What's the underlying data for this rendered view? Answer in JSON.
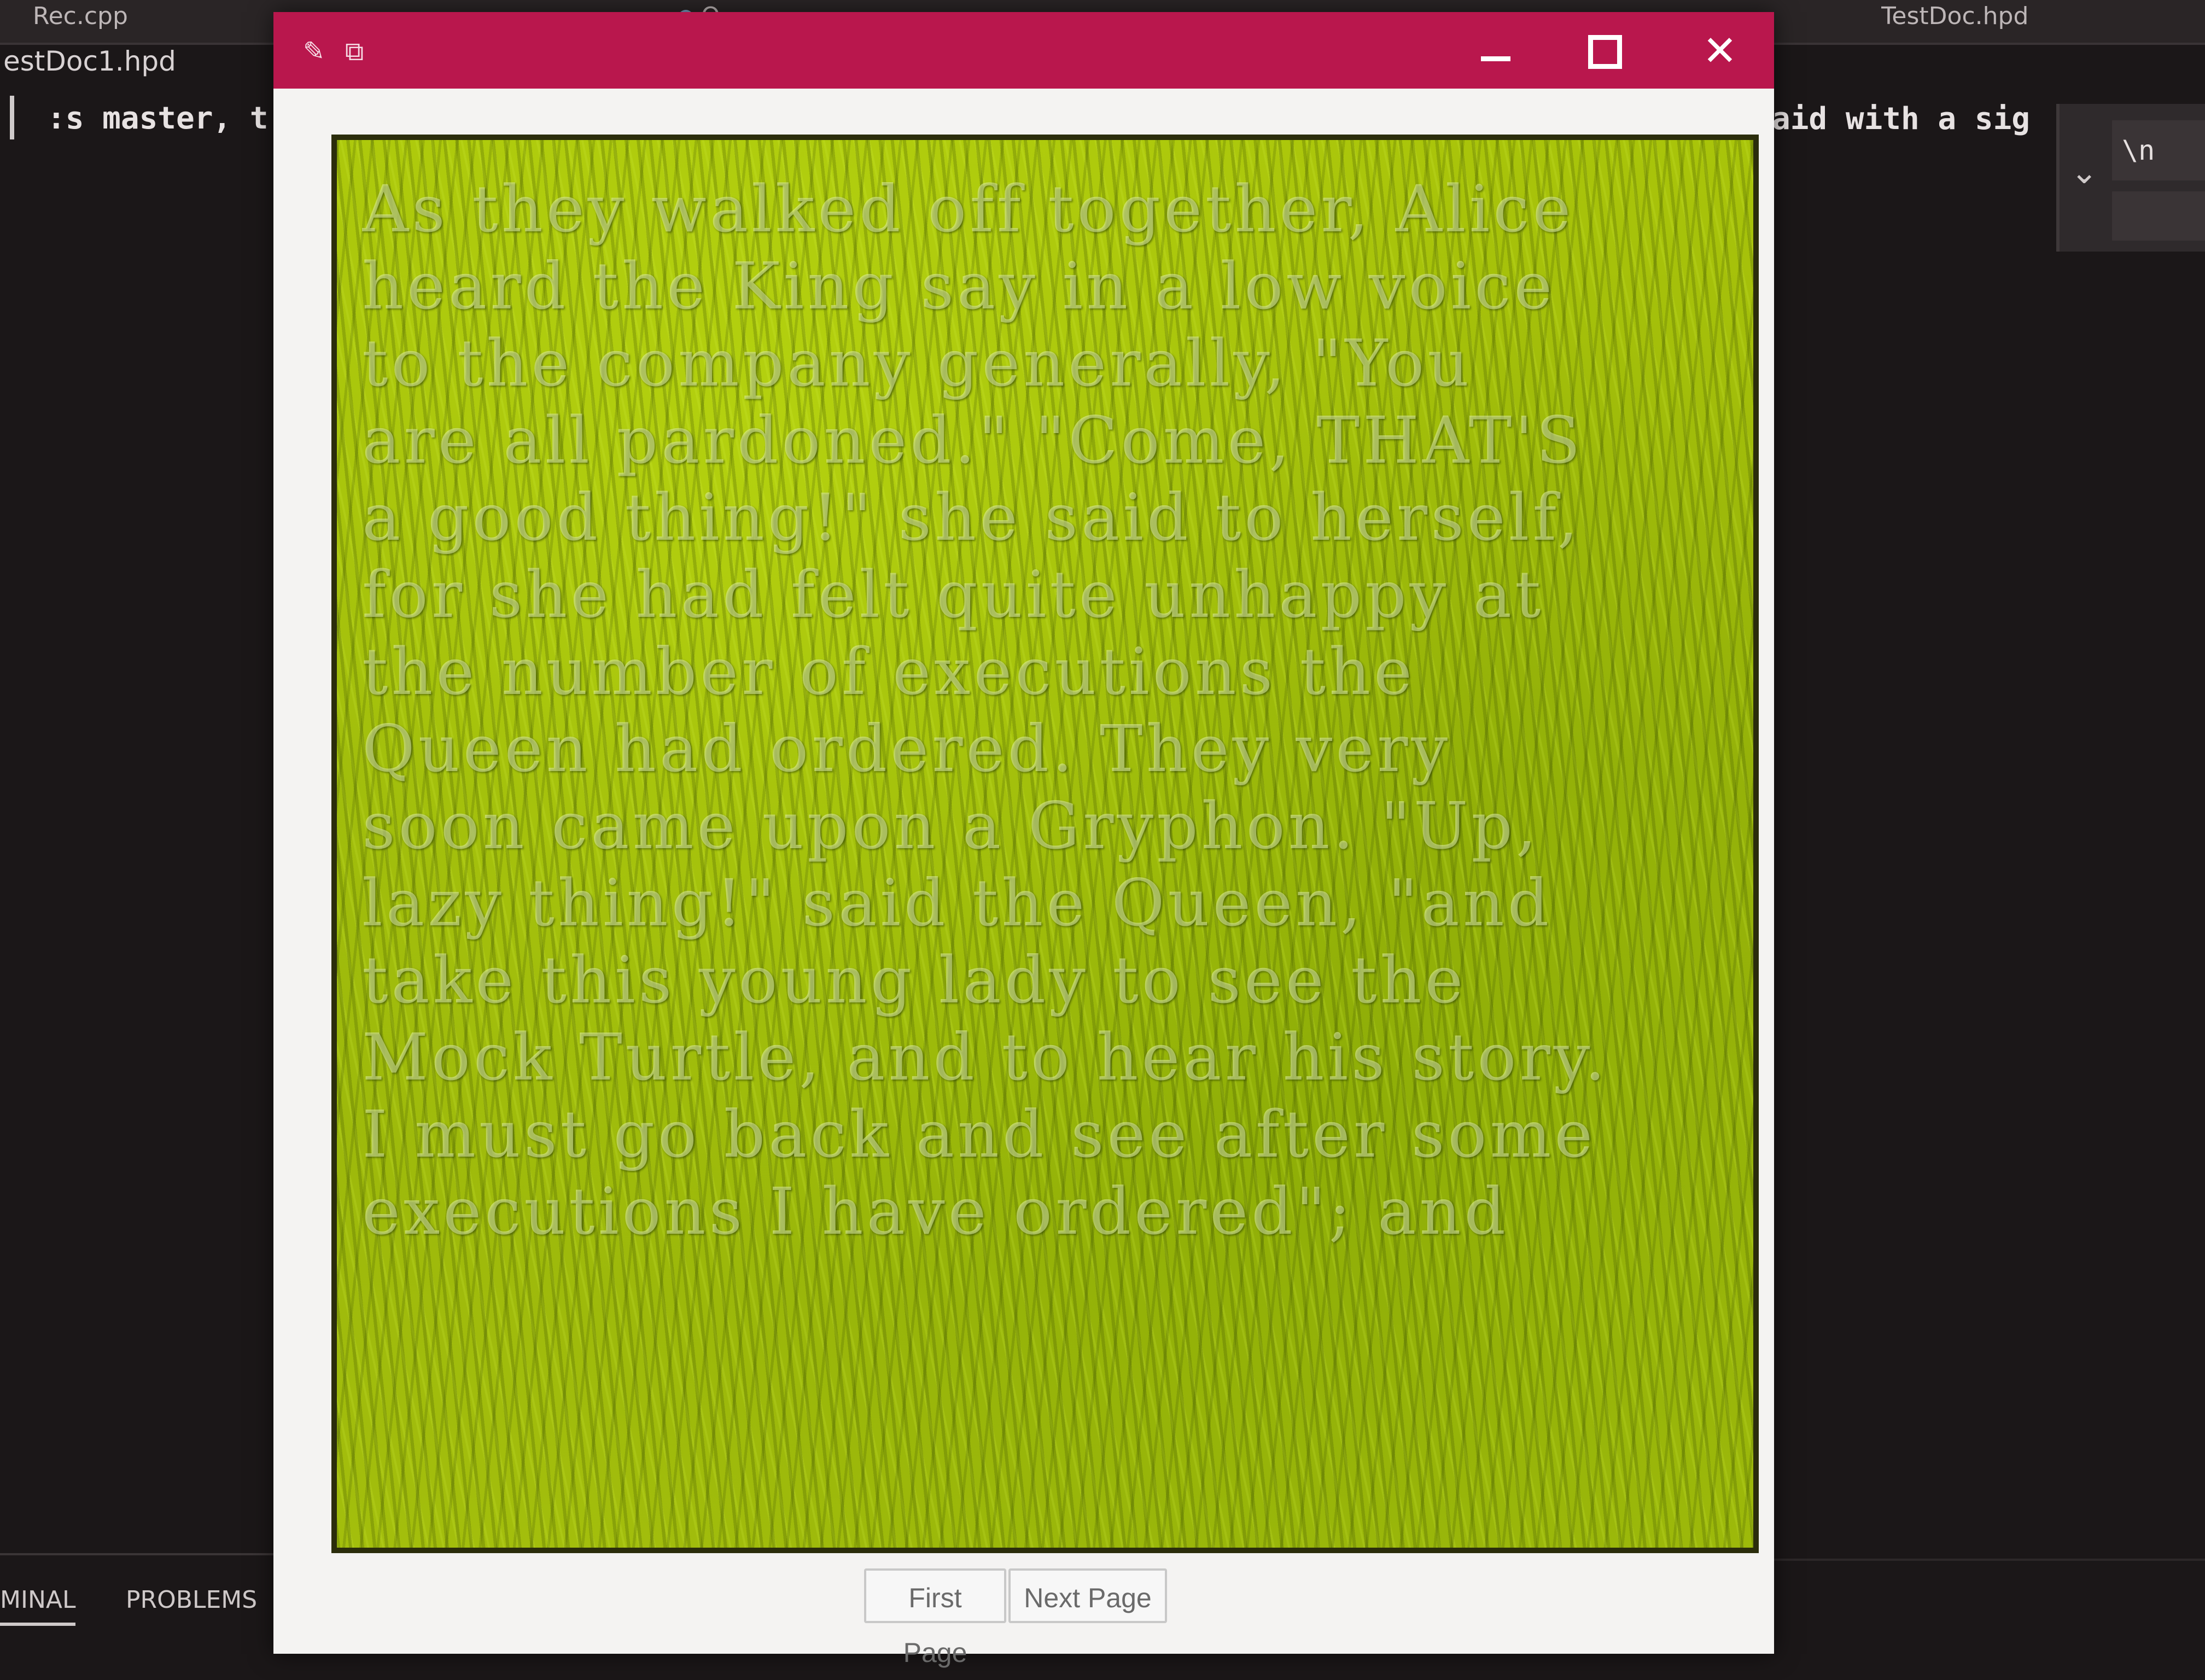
{
  "editor": {
    "tabs": [
      "Rec.cpp",
      "Q",
      "TestDoc.hpd"
    ],
    "active_file": "estDoc1.hpd",
    "code_left": ":s master, t",
    "code_right": "aid with a sig",
    "find_value": "\\n",
    "panel_tabs": [
      "MINAL",
      "PROBLEMS"
    ]
  },
  "window": {
    "title_icons": [
      "edit-icon",
      "copy-icon"
    ],
    "buttons": {
      "minimize": "—",
      "maximize": "",
      "close": "✕"
    }
  },
  "page_text": [
    "As they walked off together, Alice",
    "heard the King say in a low voice",
    "to the company generally, \"You",
    "are all pardoned.\" \"Come, THAT'S",
    "a good thing!\" she said to herself,",
    "for she had felt quite unhappy at",
    "the number of executions the",
    "Queen had ordered. They very",
    "soon came upon a Gryphon. \"Up,",
    "lazy thing!\" said the Queen, \"and",
    "take this young lady to see the",
    "Mock Turtle, and to hear his story.",
    "I must go back and see after some",
    "executions I have ordered\"; and"
  ],
  "nav": {
    "first_page": "First Page",
    "next_page": "Next Page"
  }
}
